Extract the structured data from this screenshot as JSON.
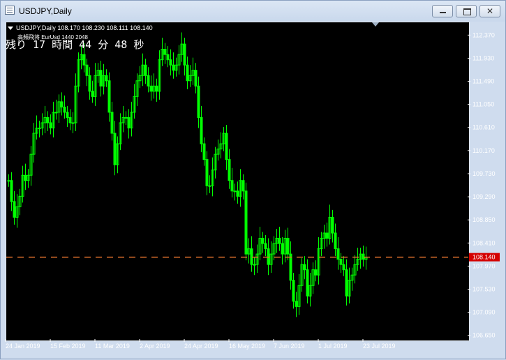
{
  "window": {
    "title": "USDJPY,Daily",
    "controls": {
      "minimize": "minimize",
      "maximize": "maximize",
      "close": "✕"
    }
  },
  "chart_header": {
    "info": "USDJPY,Daily  108.170 108.230 108.111 108.140",
    "indicator": "高頻飛将 EurUsd 1440 2048",
    "countdown": "残り 17 時間 44 分 48 秒"
  },
  "colors": {
    "background": "#000000",
    "candle": "#00ff00",
    "price_line": "#e0702c",
    "price_label_bg": "#d40000",
    "axis_text": "#ffffff"
  },
  "chart_data": {
    "type": "candlestick",
    "symbol": "USDJPY",
    "timeframe": "Daily",
    "ylim": [
      106.58,
      112.6
    ],
    "y_ticks": [
      "112.370",
      "111.930",
      "111.490",
      "111.050",
      "110.610",
      "110.170",
      "109.730",
      "109.290",
      "108.850",
      "108.410",
      "107.970",
      "107.530",
      "107.090",
      "106.650"
    ],
    "x_ticks": [
      "24 Jan 2019",
      "15 Feb 2019",
      "11 Mar 2019",
      "2 Apr 2019",
      "24 Apr 2019",
      "16 May 2019",
      "7 Jun 2019",
      "1 Jul 2019",
      "23 Jul 2019"
    ],
    "x_tick_index": [
      0,
      16,
      32,
      48,
      64,
      80,
      96,
      112,
      128
    ],
    "current_price": "108.140",
    "closes": [
      109.6,
      109.2,
      108.9,
      109.1,
      109.3,
      109.7,
      109.6,
      109.7,
      110.1,
      110.5,
      110.6,
      110.6,
      110.7,
      110.8,
      110.7,
      110.6,
      110.9,
      110.9,
      111.1,
      111.0,
      110.9,
      110.8,
      110.7,
      110.7,
      111.4,
      111.9,
      112.0,
      111.8,
      111.6,
      111.3,
      111.2,
      111.6,
      111.7,
      111.4,
      111.6,
      111.5,
      110.9,
      110.5,
      109.9,
      110.3,
      110.7,
      110.8,
      110.8,
      110.6,
      110.9,
      111.2,
      111.5,
      111.6,
      111.8,
      111.6,
      111.4,
      111.3,
      111.4,
      111.3,
      111.9,
      112.1,
      112.0,
      111.9,
      111.8,
      111.7,
      111.8,
      112.0,
      112.2,
      111.8,
      111.5,
      111.6,
      111.7,
      111.4,
      110.8,
      110.3,
      110.0,
      109.5,
      109.5,
      109.8,
      110.1,
      110.2,
      110.3,
      110.5,
      110.0,
      109.6,
      109.4,
      109.4,
      109.3,
      109.6,
      109.4,
      108.2,
      108.3,
      108.0,
      108.0,
      108.2,
      108.5,
      108.4,
      108.3,
      108.0,
      108.2,
      108.4,
      108.5,
      108.4,
      108.2,
      108.5,
      108.2,
      107.7,
      107.3,
      107.2,
      107.6,
      108.0,
      107.9,
      107.4,
      107.6,
      107.9,
      107.8,
      108.3,
      108.5,
      108.6,
      108.5,
      108.9,
      108.6,
      108.3,
      108.1,
      108.0,
      107.9,
      107.4,
      107.7,
      107.8,
      108.0,
      108.1,
      108.2,
      108.1,
      108.14
    ]
  }
}
